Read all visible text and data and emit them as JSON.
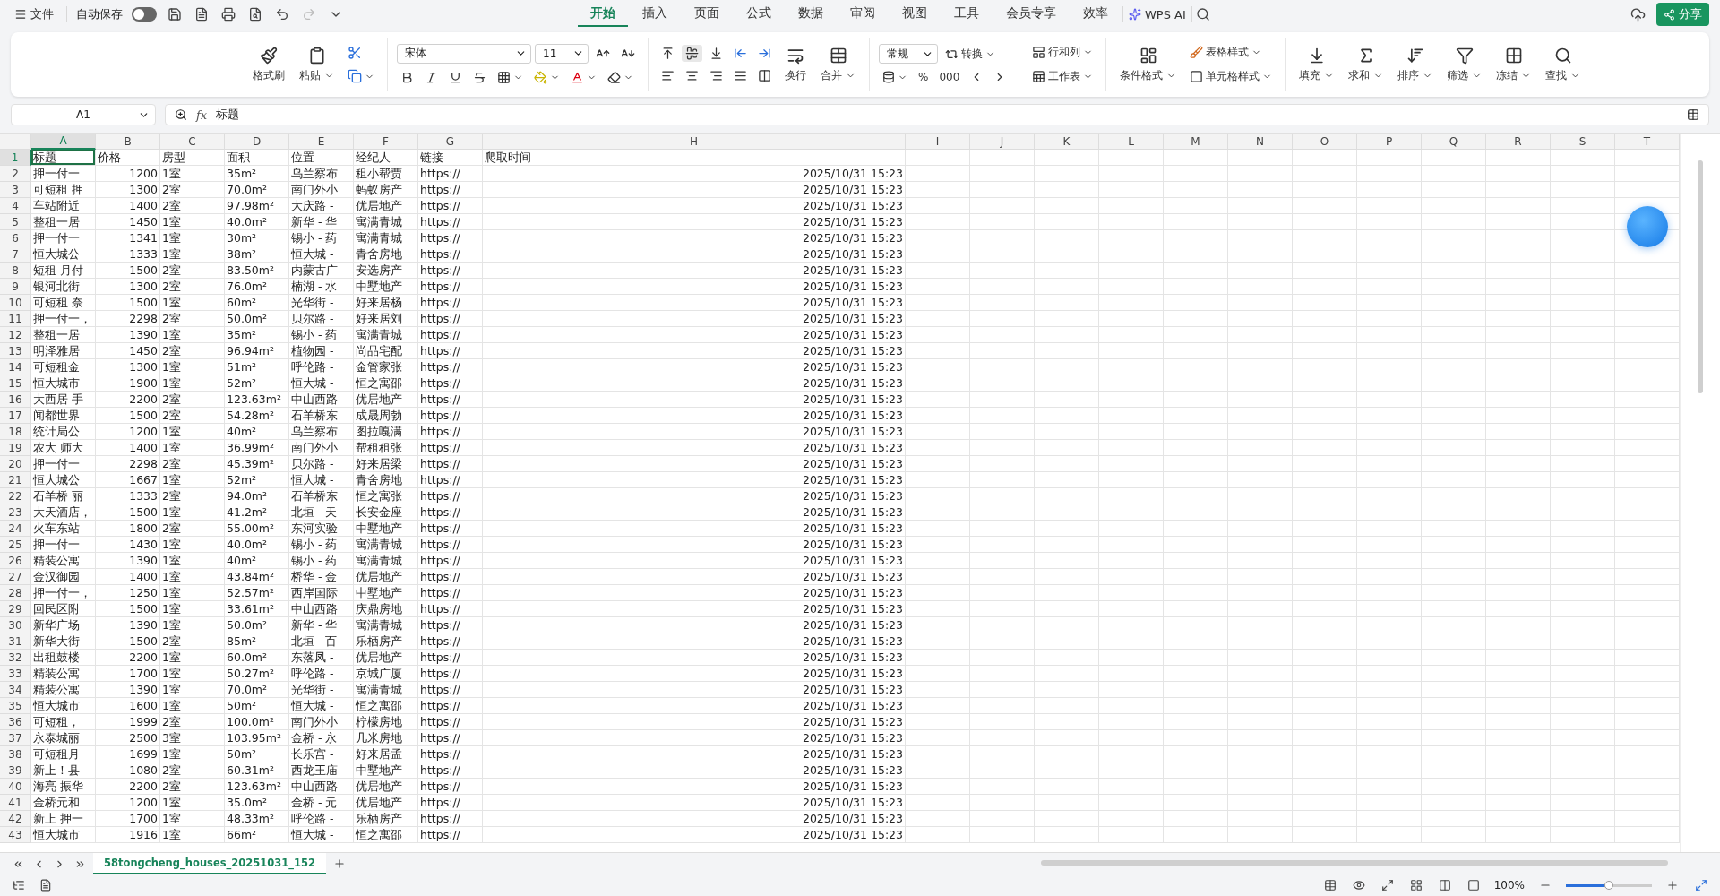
{
  "title_bar": {
    "file_menu": "文件",
    "autosave_label": "自动保存",
    "autosave_on": false,
    "tabs": [
      {
        "label": "开始",
        "selected": true
      },
      {
        "label": "插入",
        "selected": false
      },
      {
        "label": "页面",
        "selected": false
      },
      {
        "label": "公式",
        "selected": false
      },
      {
        "label": "数据",
        "selected": false
      },
      {
        "label": "审阅",
        "selected": false
      },
      {
        "label": "视图",
        "selected": false
      },
      {
        "label": "工具",
        "selected": false
      },
      {
        "label": "会员专享",
        "selected": false
      },
      {
        "label": "效率",
        "selected": false
      }
    ],
    "ai_label": "WPS AI",
    "share_label": "分享"
  },
  "ribbon": {
    "clipboard": [
      {
        "label": "格式刷",
        "kind": "brush",
        "dropdown": false
      },
      {
        "label": "粘贴",
        "kind": "paste",
        "dropdown": true
      }
    ],
    "font": {
      "name": "宋体",
      "size": "11"
    },
    "wrap_label": "换行",
    "merge_label": "合并",
    "number_format": "常规",
    "convert_label": "转换",
    "percent": "%",
    "thousands": "000",
    "rows_cols_label": "行和列",
    "worksheet_label": "工作表",
    "conditional_label": "条件格式",
    "table_style_label": "表格样式",
    "cell_style_label": "单元格样式",
    "tools": [
      {
        "label": "填充",
        "kind": "fill"
      },
      {
        "label": "求和",
        "kind": "sum"
      },
      {
        "label": "排序",
        "kind": "sort"
      },
      {
        "label": "筛选",
        "kind": "filter"
      },
      {
        "label": "冻结",
        "kind": "freeze"
      },
      {
        "label": "查找",
        "kind": "find"
      }
    ]
  },
  "formula_bar": {
    "cell_ref": "A1",
    "fx_label": "fx",
    "content": "标题"
  },
  "sheet": {
    "columns": [
      {
        "letter": "A",
        "selected": true,
        "kind": "text"
      },
      {
        "letter": "B",
        "selected": false,
        "kind": "number"
      },
      {
        "letter": "C",
        "selected": false,
        "kind": "text"
      },
      {
        "letter": "D",
        "selected": false,
        "kind": "text"
      },
      {
        "letter": "E",
        "selected": false,
        "kind": "text"
      },
      {
        "letter": "F",
        "selected": false,
        "kind": "text"
      },
      {
        "letter": "G",
        "selected": false,
        "kind": "text"
      },
      {
        "letter": "H",
        "selected": false,
        "kind": "number"
      },
      {
        "letter": "I",
        "selected": false,
        "kind": "text"
      },
      {
        "letter": "J",
        "selected": false,
        "kind": "text"
      },
      {
        "letter": "K",
        "selected": false,
        "kind": "text"
      },
      {
        "letter": "L",
        "selected": false,
        "kind": "text"
      },
      {
        "letter": "M",
        "selected": false,
        "kind": "text"
      },
      {
        "letter": "N",
        "selected": false,
        "kind": "text"
      },
      {
        "letter": "O",
        "selected": false,
        "kind": "text"
      },
      {
        "letter": "P",
        "selected": false,
        "kind": "text"
      },
      {
        "letter": "Q",
        "selected": false,
        "kind": "text"
      },
      {
        "letter": "R",
        "selected": false,
        "kind": "text"
      },
      {
        "letter": "S",
        "selected": false,
        "kind": "text"
      },
      {
        "letter": "T",
        "selected": false,
        "kind": "text"
      }
    ],
    "rows": [
      {
        "number": "1",
        "selected": true,
        "cells": [
          "标题",
          "价格",
          "房型",
          "面积",
          "位置",
          "经纪人",
          "链接",
          "爬取时间"
        ]
      },
      {
        "number": "2",
        "selected": false,
        "cells": [
          "押一付一",
          "1200",
          "1室",
          "35m²",
          "乌兰察布",
          "租小帮贾",
          "https://",
          "2025/10/31 15:23"
        ]
      },
      {
        "number": "3",
        "selected": false,
        "cells": [
          "可短租 押",
          "1300",
          "2室",
          "70.0m²",
          "南门外小",
          "蚂蚁房产",
          "https://",
          "2025/10/31 15:23"
        ]
      },
      {
        "number": "4",
        "selected": false,
        "cells": [
          "车站附近",
          "1400",
          "2室",
          "97.98m²",
          "大庆路 -",
          "优居地产",
          "https://",
          "2025/10/31 15:23"
        ]
      },
      {
        "number": "5",
        "selected": false,
        "cells": [
          "整租一居",
          "1450",
          "1室",
          "40.0m²",
          "新华 - 华",
          "寓满青城",
          "https://",
          "2025/10/31 15:23"
        ]
      },
      {
        "number": "6",
        "selected": false,
        "cells": [
          "押一付一",
          "1341",
          "1室",
          "30m²",
          "锡小 - 药",
          "寓满青城",
          "https://",
          "2025/10/31 15:23"
        ]
      },
      {
        "number": "7",
        "selected": false,
        "cells": [
          "恒大城公",
          "1333",
          "1室",
          "38m²",
          "恒大城 -",
          "青舍房地",
          "https://",
          "2025/10/31 15:23"
        ]
      },
      {
        "number": "8",
        "selected": false,
        "cells": [
          "短租 月付",
          "1500",
          "2室",
          "83.50m²",
          "内蒙古广",
          "安选房产",
          "https://",
          "2025/10/31 15:23"
        ]
      },
      {
        "number": "9",
        "selected": false,
        "cells": [
          "银河北街",
          "1300",
          "2室",
          "76.0m²",
          "楠湖 - 水",
          "中墅地产",
          "https://",
          "2025/10/31 15:23"
        ]
      },
      {
        "number": "10",
        "selected": false,
        "cells": [
          "可短租 奈",
          "1500",
          "1室",
          "60m²",
          "光华街 -",
          "好来居杨",
          "https://",
          "2025/10/31 15:23"
        ]
      },
      {
        "number": "11",
        "selected": false,
        "cells": [
          "押一付一，",
          "2298",
          "2室",
          "50.0m²",
          "贝尔路 -",
          "好来居刘",
          "https://",
          "2025/10/31 15:23"
        ]
      },
      {
        "number": "12",
        "selected": false,
        "cells": [
          "整租一居",
          "1390",
          "1室",
          "35m²",
          "锡小 - 药",
          "寓满青城",
          "https://",
          "2025/10/31 15:23"
        ]
      },
      {
        "number": "13",
        "selected": false,
        "cells": [
          "明泽雅居",
          "1450",
          "2室",
          "96.94m²",
          "植物园 -",
          "尚品宅配",
          "https://",
          "2025/10/31 15:23"
        ]
      },
      {
        "number": "14",
        "selected": false,
        "cells": [
          "可短租金",
          "1300",
          "1室",
          "51m²",
          "呼伦路 -",
          "金管家张",
          "https://",
          "2025/10/31 15:23"
        ]
      },
      {
        "number": "15",
        "selected": false,
        "cells": [
          "恒大城市",
          "1900",
          "1室",
          "52m²",
          "恒大城 -",
          "恒之寓邵",
          "https://",
          "2025/10/31 15:23"
        ]
      },
      {
        "number": "16",
        "selected": false,
        "cells": [
          "大西居 手",
          "2200",
          "2室",
          "123.63m²",
          "中山西路",
          "优居地产",
          "https://",
          "2025/10/31 15:23"
        ]
      },
      {
        "number": "17",
        "selected": false,
        "cells": [
          "闻都世界",
          "1500",
          "2室",
          "54.28m²",
          "石羊桥东",
          "成晟周勃",
          "https://",
          "2025/10/31 15:23"
        ]
      },
      {
        "number": "18",
        "selected": false,
        "cells": [
          "统计局公",
          "1200",
          "1室",
          "40m²",
          "乌兰察布",
          "图拉嘎满",
          "https://",
          "2025/10/31 15:23"
        ]
      },
      {
        "number": "19",
        "selected": false,
        "cells": [
          "农大 师大",
          "1400",
          "1室",
          "36.99m²",
          "南门外小",
          "帮租租张",
          "https://",
          "2025/10/31 15:23"
        ]
      },
      {
        "number": "20",
        "selected": false,
        "cells": [
          "押一付一",
          "2298",
          "2室",
          "45.39m²",
          "贝尔路 -",
          "好来居梁",
          "https://",
          "2025/10/31 15:23"
        ]
      },
      {
        "number": "21",
        "selected": false,
        "cells": [
          "恒大城公",
          "1667",
          "1室",
          "52m²",
          "恒大城 -",
          "青舍房地",
          "https://",
          "2025/10/31 15:23"
        ]
      },
      {
        "number": "22",
        "selected": false,
        "cells": [
          "石羊桥 丽",
          "1333",
          "2室",
          "94.0m²",
          "石羊桥东",
          "恒之寓张",
          "https://",
          "2025/10/31 15:23"
        ]
      },
      {
        "number": "23",
        "selected": false,
        "cells": [
          "大天酒店，",
          "1500",
          "1室",
          "41.2m²",
          "北垣 - 天",
          "长安金座",
          "https://",
          "2025/10/31 15:23"
        ]
      },
      {
        "number": "24",
        "selected": false,
        "cells": [
          "火车东站",
          "1800",
          "2室",
          "55.00m²",
          "东河实验",
          "中墅地产",
          "https://",
          "2025/10/31 15:23"
        ]
      },
      {
        "number": "25",
        "selected": false,
        "cells": [
          "押一付一",
          "1430",
          "1室",
          "40.0m²",
          "锡小 - 药",
          "寓满青城",
          "https://",
          "2025/10/31 15:23"
        ]
      },
      {
        "number": "26",
        "selected": false,
        "cells": [
          "精装公寓",
          "1390",
          "1室",
          "40m²",
          "锡小 - 药",
          "寓满青城",
          "https://",
          "2025/10/31 15:23"
        ]
      },
      {
        "number": "27",
        "selected": false,
        "cells": [
          "金汉御园",
          "1400",
          "1室",
          "43.84m²",
          "桥华 - 金",
          "优居地产",
          "https://",
          "2025/10/31 15:23"
        ]
      },
      {
        "number": "28",
        "selected": false,
        "cells": [
          "押一付一，",
          "1250",
          "1室",
          "52.57m²",
          "西岸国际",
          "中墅地产",
          "https://",
          "2025/10/31 15:23"
        ]
      },
      {
        "number": "29",
        "selected": false,
        "cells": [
          "回民区附",
          "1500",
          "1室",
          "33.61m²",
          "中山西路",
          "庆鼎房地",
          "https://",
          "2025/10/31 15:23"
        ]
      },
      {
        "number": "30",
        "selected": false,
        "cells": [
          "新华广场",
          "1390",
          "1室",
          "50.0m²",
          "新华 - 华",
          "寓满青城",
          "https://",
          "2025/10/31 15:23"
        ]
      },
      {
        "number": "31",
        "selected": false,
        "cells": [
          "新华大街",
          "1500",
          "2室",
          "85m²",
          "北垣 - 百",
          "乐栖房产",
          "https://",
          "2025/10/31 15:23"
        ]
      },
      {
        "number": "32",
        "selected": false,
        "cells": [
          "出租鼓楼",
          "2200",
          "1室",
          "60.0m²",
          "东落凤 -",
          "优居地产",
          "https://",
          "2025/10/31 15:23"
        ]
      },
      {
        "number": "33",
        "selected": false,
        "cells": [
          "精装公寓",
          "1700",
          "1室",
          "50.27m²",
          "呼伦路 -",
          "京城广厦",
          "https://",
          "2025/10/31 15:23"
        ]
      },
      {
        "number": "34",
        "selected": false,
        "cells": [
          "精装公寓",
          "1390",
          "1室",
          "70.0m²",
          "光华街 -",
          "寓满青城",
          "https://",
          "2025/10/31 15:23"
        ]
      },
      {
        "number": "35",
        "selected": false,
        "cells": [
          "恒大城市",
          "1600",
          "1室",
          "50m²",
          "恒大城 -",
          "恒之寓邵",
          "https://",
          "2025/10/31 15:23"
        ]
      },
      {
        "number": "36",
        "selected": false,
        "cells": [
          "可短租，",
          "1999",
          "2室",
          "100.0m²",
          "南门外小",
          "柠檬房地",
          "https://",
          "2025/10/31 15:23"
        ]
      },
      {
        "number": "37",
        "selected": false,
        "cells": [
          "永泰城丽",
          "2500",
          "3室",
          "103.95m²",
          "金桥 - 永",
          "几米房地",
          "https://",
          "2025/10/31 15:23"
        ]
      },
      {
        "number": "38",
        "selected": false,
        "cells": [
          "可短租月",
          "1699",
          "1室",
          "50m²",
          "长乐宫 -",
          "好来居孟",
          "https://",
          "2025/10/31 15:23"
        ]
      },
      {
        "number": "39",
        "selected": false,
        "cells": [
          "新上！县",
          "1080",
          "2室",
          "60.31m²",
          "西龙王庙",
          "中墅地产",
          "https://",
          "2025/10/31 15:23"
        ]
      },
      {
        "number": "40",
        "selected": false,
        "cells": [
          "海亮 振华",
          "2200",
          "2室",
          "123.63m²",
          "中山西路",
          "优居地产",
          "https://",
          "2025/10/31 15:23"
        ]
      },
      {
        "number": "41",
        "selected": false,
        "cells": [
          "金桥元和",
          "1200",
          "1室",
          "35.0m²",
          "金桥 - 元",
          "优居地产",
          "https://",
          "2025/10/31 15:23"
        ]
      },
      {
        "number": "42",
        "selected": false,
        "cells": [
          "新上 押一",
          "1700",
          "1室",
          "48.33m²",
          "呼伦路 -",
          "乐栖房产",
          "https://",
          "2025/10/31 15:23"
        ]
      },
      {
        "number": "43",
        "selected": false,
        "cells": [
          "恒大城市",
          "1916",
          "1室",
          "66m²",
          "恒大城 -",
          "恒之寓邵",
          "https://",
          "2025/10/31 15:23"
        ]
      }
    ]
  },
  "sheet_tabs": [
    {
      "label": "58tongcheng_houses_20251031_152",
      "selected": true
    }
  ],
  "status_bar": {
    "zoom": "100%",
    "zoom_slider": {
      "level": 0.5
    }
  }
}
